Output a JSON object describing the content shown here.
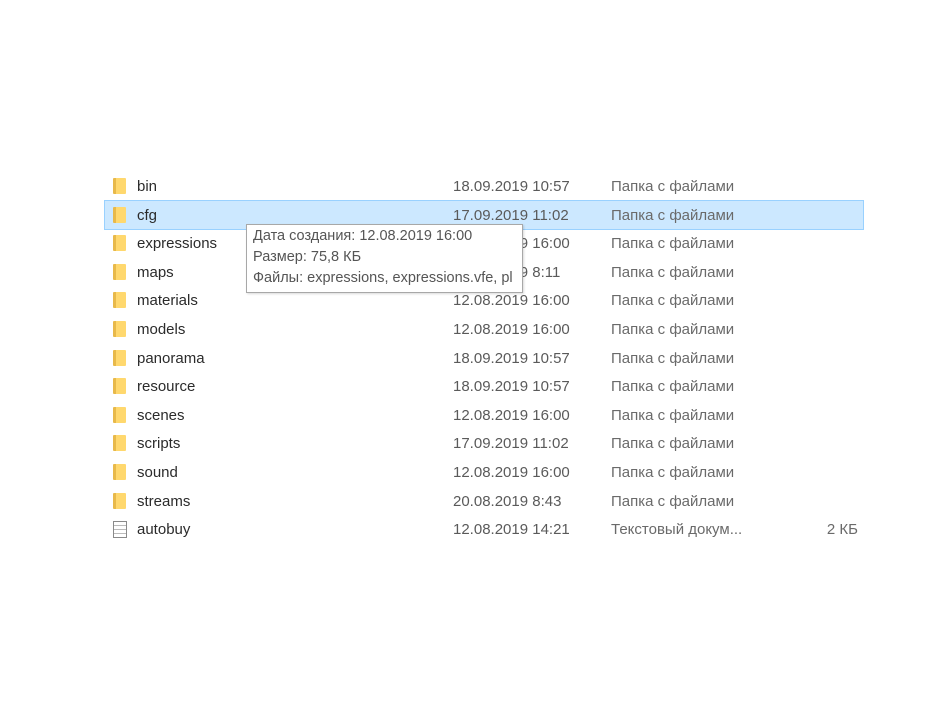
{
  "files": [
    {
      "name": "bin",
      "date": "18.09.2019 10:57",
      "type": "Папка с файлами",
      "size": "",
      "icon": "folder-icon"
    },
    {
      "name": "cfg",
      "date": "17.09.2019 11:02",
      "type": "Папка с файлами",
      "size": "",
      "icon": "folder-icon",
      "selected": true
    },
    {
      "name": "expressions",
      "date": "12.08.2019 16:00",
      "type": "Папка с файлами",
      "size": "",
      "icon": "folder-icon"
    },
    {
      "name": "maps",
      "date": "20.08.2019 8:11",
      "type": "Папка с файлами",
      "size": "",
      "icon": "folder-icon"
    },
    {
      "name": "materials",
      "date": "12.08.2019 16:00",
      "type": "Папка с файлами",
      "size": "",
      "icon": "folder-icon"
    },
    {
      "name": "models",
      "date": "12.08.2019 16:00",
      "type": "Папка с файлами",
      "size": "",
      "icon": "folder-icon"
    },
    {
      "name": "panorama",
      "date": "18.09.2019 10:57",
      "type": "Папка с файлами",
      "size": "",
      "icon": "folder-icon"
    },
    {
      "name": "resource",
      "date": "18.09.2019 10:57",
      "type": "Папка с файлами",
      "size": "",
      "icon": "folder-icon"
    },
    {
      "name": "scenes",
      "date": "12.08.2019 16:00",
      "type": "Папка с файлами",
      "size": "",
      "icon": "folder-icon"
    },
    {
      "name": "scripts",
      "date": "17.09.2019 11:02",
      "type": "Папка с файлами",
      "size": "",
      "icon": "folder-icon"
    },
    {
      "name": "sound",
      "date": "12.08.2019 16:00",
      "type": "Папка с файлами",
      "size": "",
      "icon": "folder-icon"
    },
    {
      "name": "streams",
      "date": "20.08.2019 8:43",
      "type": "Папка с файлами",
      "size": "",
      "icon": "folder-icon"
    },
    {
      "name": "autobuy",
      "date": "12.08.2019 14:21",
      "type": "Текстовый докум...",
      "size": "2 КБ",
      "icon": "text-file-icon"
    }
  ],
  "tooltip": {
    "created": "Дата создания: 12.08.2019 16:00",
    "size": "Размер: 75,8 КБ",
    "files": "Файлы: expressions, expressions.vfe, pl"
  },
  "colors": {
    "selection": "#cce8ff",
    "selection_border": "#99d1ff",
    "folder": "#ffd86e"
  }
}
